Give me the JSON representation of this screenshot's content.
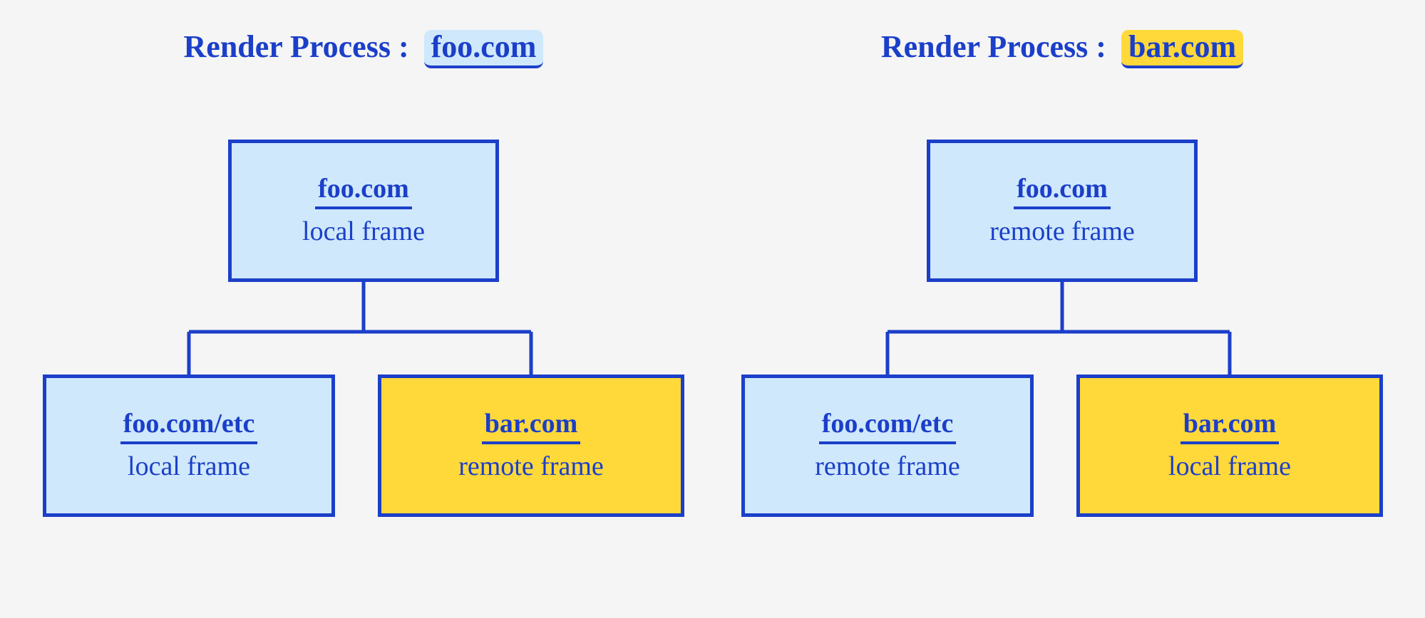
{
  "colors": {
    "ink": "#1b3fc9",
    "blue_fill": "#cfe8fb",
    "yellow_fill": "#ffd83a",
    "page_bg": "#f5f5f5"
  },
  "processes": [
    {
      "title_prefix": "Render Process :",
      "title_domain": "foo.com",
      "title_chip_color": "blue",
      "parent": {
        "url": "foo.com",
        "frame_type": "local frame",
        "fill": "blue"
      },
      "child_left": {
        "url": "foo.com/etc",
        "frame_type": "local frame",
        "fill": "blue"
      },
      "child_right": {
        "url": "bar.com",
        "frame_type": "remote frame",
        "fill": "yellow"
      }
    },
    {
      "title_prefix": "Render Process :",
      "title_domain": "bar.com",
      "title_chip_color": "yellow",
      "parent": {
        "url": "foo.com",
        "frame_type": "remote frame",
        "fill": "blue"
      },
      "child_left": {
        "url": "foo.com/etc",
        "frame_type": "remote frame",
        "fill": "blue"
      },
      "child_right": {
        "url": "bar.com",
        "frame_type": "local frame",
        "fill": "yellow"
      }
    }
  ]
}
